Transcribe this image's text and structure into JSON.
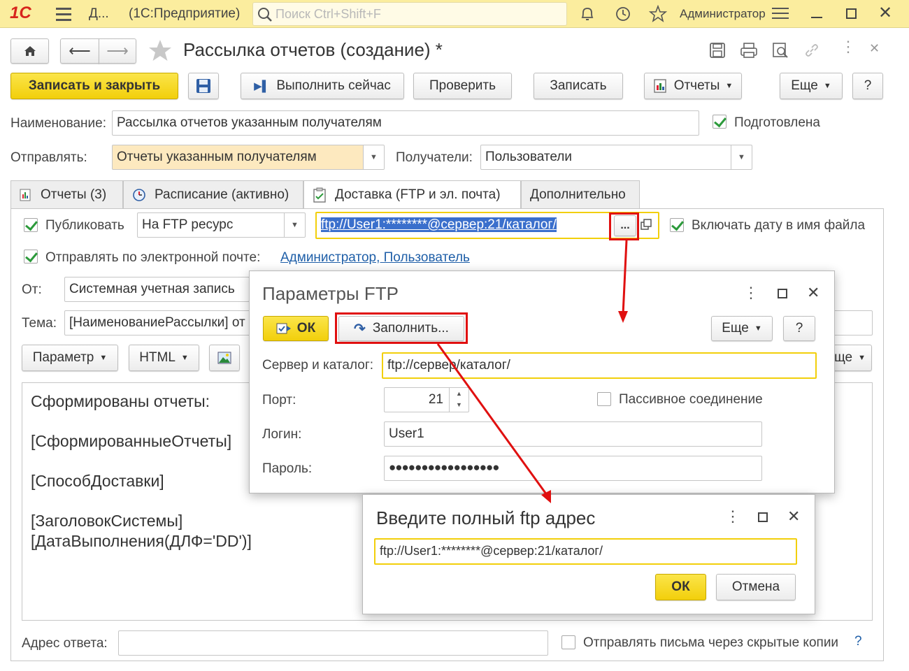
{
  "topbar": {
    "logo": "1С",
    "nav_short": "Д...",
    "app_name": "(1С:Предприятие)",
    "search_placeholder": "Поиск Ctrl+Shift+F",
    "user": "Администратор"
  },
  "window": {
    "title": "Рассылка отчетов (создание) *"
  },
  "toolbar": {
    "save_close": "Записать и закрыть",
    "run_now": "Выполнить сейчас",
    "check": "Проверить",
    "save": "Записать",
    "reports": "Отчеты",
    "more": "Еще",
    "help": "?"
  },
  "form": {
    "name_label": "Наименование:",
    "name_value": "Рассылка отчетов указанным получателям",
    "prepared_label": "Подготовлена",
    "send_label": "Отправлять:",
    "send_value": "Отчеты указанным получателям",
    "recipients_label": "Получатели:",
    "recipients_value": "Пользователи"
  },
  "tabs": [
    {
      "label": "Отчеты (3)"
    },
    {
      "label": "Расписание (активно)"
    },
    {
      "label": "Доставка (FTP и эл. почта)"
    },
    {
      "label": "Дополнительно"
    }
  ],
  "delivery": {
    "publish_label": "Публиковать",
    "publish_target": "На FTP ресурс",
    "ftp_value": "ftp://User1:********@сервер:21/каталог/",
    "ellipsis": "...",
    "include_date_label": "Включать дату в имя файла",
    "email_label": "Отправлять по электронной почте:",
    "email_recipients": "Администратор, Пользователь",
    "from_label": "От:",
    "from_value": "Системная учетная запись",
    "subject_label": "Тема:",
    "subject_value": "[НаименованиеРассылки] от",
    "param_btn": "Параметр",
    "html_btn": "HTML",
    "more_btn_partial": "ще",
    "body_lines": [
      "Сформированы отчеты:",
      "",
      "[СформированныеОтчеты]",
      "",
      "[СпособДоставки]",
      "",
      "[ЗаголовокСистемы]",
      "[ДатаВыполнения(ДЛФ='DD')]"
    ],
    "reply_label": "Адрес ответа:",
    "bcc_label": "Отправлять письма через скрытые копии",
    "help_q": "?"
  },
  "ftp_dialog": {
    "title": "Параметры FTP",
    "ok": "ОК",
    "fill": "Заполнить...",
    "more": "Еще",
    "help": "?",
    "server_label": "Сервер и каталог:",
    "server_value": "ftp://сервер/каталог/",
    "port_label": "Порт:",
    "port_value": "21",
    "passive_label": "Пассивное соединение",
    "login_label": "Логин:",
    "login_value": "User1",
    "password_label": "Пароль:",
    "password_value": "●●●●●●●●●●●●●●●●●"
  },
  "address_dialog": {
    "title": "Введите полный ftp адрес",
    "value": "ftp://User1:********@сервер:21/каталог/",
    "ok": "ОК",
    "cancel": "Отмена"
  },
  "colors": {
    "topbar": "#fbed9e",
    "accent_yellow": "#f2cf0b",
    "highlight_red": "#e01010",
    "check_green": "#2c9a3b",
    "link_blue": "#1f5fa8"
  }
}
